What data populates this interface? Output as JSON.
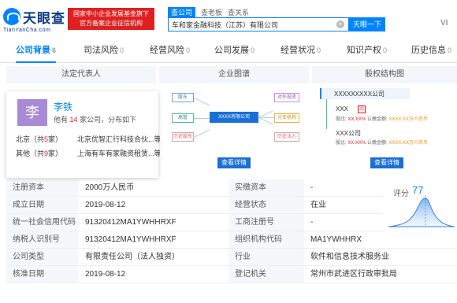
{
  "header": {
    "logo_text": "天眼查",
    "logo_sub": "TianYanCha.com",
    "badge_line1": "国家中小企业发展基金旗下",
    "badge_line2": "官方备案企业征信机构",
    "search_tabs": [
      "查公司",
      "查老板",
      "查关系"
    ],
    "search_value": "车和家金融科技（江苏）有限公司",
    "search_button": "天眼一下",
    "vip": "VI"
  },
  "nav": {
    "tabs": [
      {
        "label": "公司背景",
        "count": "6"
      },
      {
        "label": "司法风险",
        "count": "0"
      },
      {
        "label": "经营风险",
        "count": "0"
      },
      {
        "label": "公司发展",
        "count": "0"
      },
      {
        "label": "经营状况",
        "count": "0"
      },
      {
        "label": "知识产权",
        "count": "0"
      },
      {
        "label": "历史信息",
        "count": "0"
      }
    ]
  },
  "panels": {
    "legal_rep_title": "法定代表人",
    "map_title": "企业图谱",
    "equity_title": "股权结构图",
    "view_detail": "查看详情"
  },
  "legal_rep": {
    "avatar_char": "李",
    "name": "李铁",
    "desc_prefix": "他有",
    "desc_count": "14",
    "desc_suffix": "家公司，分布如下",
    "rows": [
      {
        "region": "北京",
        "prefix": "（共",
        "count": "5",
        "suffix": "家）",
        "company": "北京优智汇行科技合伙...等"
      },
      {
        "region": "其他",
        "prefix": "（共",
        "count": "9",
        "suffix": "家）",
        "company": "上海有车有家融资租赁...等"
      }
    ]
  },
  "map": {
    "left_nodes": [
      "股东",
      "高管",
      "历史股东"
    ],
    "center_node": "XXXX有限公司",
    "right_nodes": [
      "对外投资",
      "分支机构",
      "历史法人"
    ]
  },
  "equity": {
    "root": "XXXXXXXXX公司",
    "holder1": "XXX",
    "holder1_line_label": "股比:",
    "holder1_ratio": "XX.XX%",
    "holder1_capital_label": "认缴金额:",
    "holder1_capital": "XXXX.XX万人民币",
    "holder2": "XXX公司",
    "holder2_line_label": "股比:",
    "holder2_ratio": "XX.XX%",
    "holder2_capital_label": "认缴金额:",
    "holder2_capital": "XXXX.XX万人民币"
  },
  "info": {
    "rows": [
      {
        "l1": "注册资本",
        "v1": "2000万人民币",
        "l2": "实缴资本",
        "v2": "-"
      },
      {
        "l1": "成立日期",
        "v1": "2019-08-12",
        "l2": "经营状态",
        "v2": "在业"
      },
      {
        "l1": "统一社会信用代码",
        "v1": "91320412MA1YWHHRXF",
        "l2": "工商注册号",
        "v2": "-"
      },
      {
        "l1": "纳税人识别号",
        "v1": "91320412MA1YWHHRXF",
        "l2": "组织机构代码",
        "v2": "MA1YWHHRX"
      },
      {
        "l1": "公司类型",
        "v1": "有限责任公司（法人独资）",
        "l2": "行业",
        "v2": "软件和信息技术服务业"
      },
      {
        "l1": "核准日期",
        "v1": "2019-08-12",
        "l2": "登记机关",
        "v2": "常州市武进区行政审批局"
      }
    ],
    "score_label": "评分",
    "score_value": "77"
  }
}
